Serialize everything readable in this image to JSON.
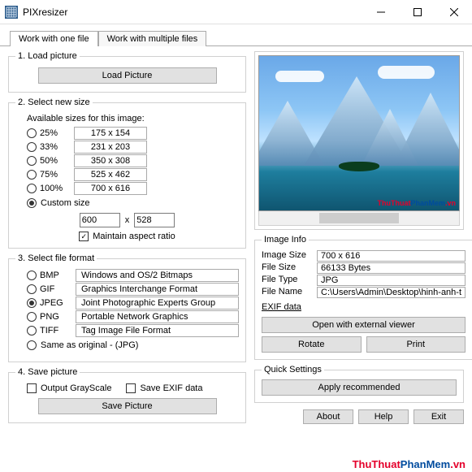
{
  "window": {
    "title": "PIXresizer"
  },
  "tabs": [
    {
      "label": "Work with one file",
      "active": true
    },
    {
      "label": "Work with multiple files",
      "active": false
    }
  ],
  "section1": {
    "legend": "1. Load picture",
    "load_button": "Load Picture"
  },
  "section2": {
    "legend": "2. Select new size",
    "available_label": "Available sizes for this image:",
    "sizes": [
      {
        "pct": "25%",
        "dim": "175  x  154"
      },
      {
        "pct": "33%",
        "dim": "231  x  203"
      },
      {
        "pct": "50%",
        "dim": "350  x  308"
      },
      {
        "pct": "75%",
        "dim": "525  x  462"
      },
      {
        "pct": "100%",
        "dim": "700  x  616"
      }
    ],
    "custom_label": "Custom size",
    "custom_w": "600",
    "x": "x",
    "custom_h": "528",
    "maintain_label": "Maintain aspect ratio"
  },
  "section3": {
    "legend": "3. Select file format",
    "formats": [
      {
        "code": "BMP",
        "desc": "Windows and OS/2 Bitmaps"
      },
      {
        "code": "GIF",
        "desc": "Graphics Interchange Format"
      },
      {
        "code": "JPEG",
        "desc": "Joint Photographic Experts Group"
      },
      {
        "code": "PNG",
        "desc": "Portable Network Graphics"
      },
      {
        "code": "TIFF",
        "desc": "Tag Image File Format"
      }
    ],
    "same_label": "Same as original  - (JPG)"
  },
  "section4": {
    "legend": "4. Save picture",
    "grayscale_label": "Output GrayScale",
    "exif_label": "Save EXIF data",
    "save_button": "Save Picture"
  },
  "imageinfo": {
    "legend": "Image Info",
    "rows": [
      {
        "label": "Image Size",
        "value": "700 x 616"
      },
      {
        "label": "File Size",
        "value": "66133 Bytes"
      },
      {
        "label": "File Type",
        "value": "JPG"
      },
      {
        "label": "File Name",
        "value": "C:\\Users\\Admin\\Desktop\\hinh-anh-t"
      }
    ],
    "exif_link": "EXIF data",
    "open_btn": "Open with external viewer",
    "rotate_btn": "Rotate",
    "print_btn": "Print"
  },
  "quick": {
    "legend": "Quick Settings",
    "apply_btn": "Apply recommended"
  },
  "bottom": {
    "about": "About",
    "help": "Help",
    "exit": "Exit"
  },
  "watermark": {
    "t1": "ThuThuat",
    "t2": "PhanMem",
    "t3": ".vn"
  }
}
